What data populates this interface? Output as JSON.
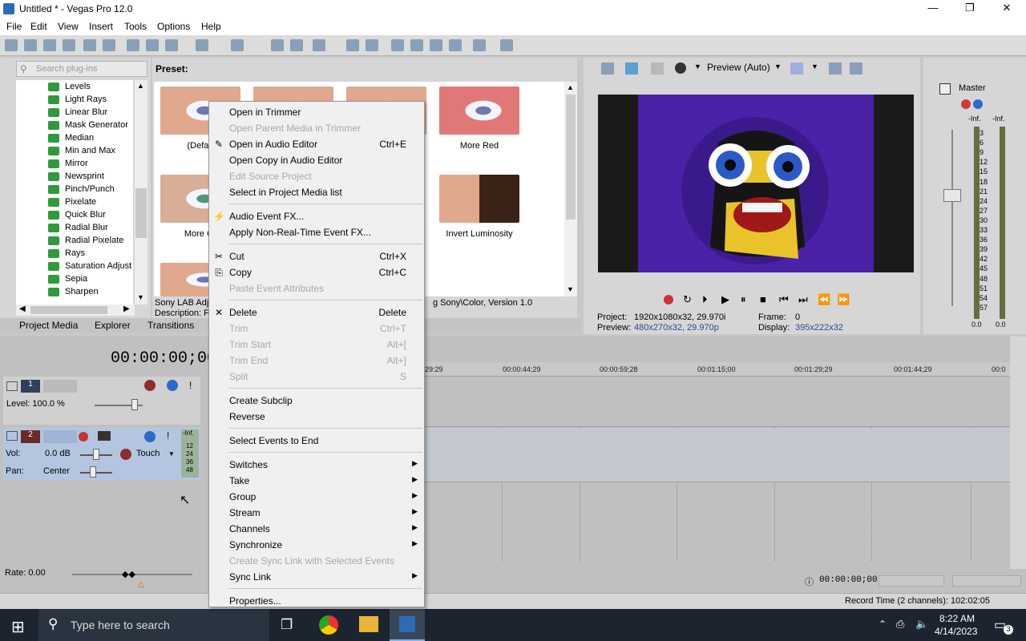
{
  "window": {
    "title": "Untitled * - Vegas Pro 12.0",
    "minimize": "—",
    "maximize": "❐",
    "close": "✕"
  },
  "menu": [
    "File",
    "Edit",
    "View",
    "Insert",
    "Tools",
    "Options",
    "Help"
  ],
  "plugins": {
    "search_placeholder": "Search plug-ins",
    "items": [
      "Levels",
      "Light Rays",
      "Linear Blur",
      "Mask Generator",
      "Median",
      "Min and Max",
      "Mirror",
      "Newsprint",
      "Pinch/Punch",
      "Pixelate",
      "Quick Blur",
      "Radial Blur",
      "Radial Pixelate",
      "Rays",
      "Saturation Adjust",
      "Sepia",
      "Sharpen"
    ]
  },
  "presets": {
    "label": "Preset:",
    "items": [
      "(Defau",
      "More Red",
      "More Gr",
      "Invert Luminosity"
    ],
    "info_line1": "Sony LAB Adju",
    "info_line1_end": "g Sony\\Color, Version 1.0",
    "info_line2": "Description: F"
  },
  "tabs": [
    "Project Media",
    "Explorer",
    "Transitions"
  ],
  "preview": {
    "mode": "Preview (Auto)",
    "project_label": "Project:",
    "project_value": "1920x1080x32, 29.970i",
    "preview_label": "Preview:",
    "preview_value": "480x270x32, 29.970p",
    "frame_label": "Frame:",
    "frame_value": "0",
    "display_label": "Display:",
    "display_value": "395x222x32"
  },
  "mixer": {
    "title": "Master",
    "left_inf": "-Inf.",
    "right_inf": "-Inf.",
    "scale": [
      "3",
      "6",
      "9",
      "12",
      "15",
      "18",
      "21",
      "24",
      "27",
      "30",
      "33",
      "36",
      "39",
      "42",
      "45",
      "48",
      "51",
      "54",
      "57"
    ],
    "left_level": "0.0",
    "right_level": "0.0"
  },
  "timeline": {
    "timecode": "00:00:00;00",
    "ruler": [
      "29:29",
      "00:00:44;29",
      "00:00:59;28",
      "00:01:15;00",
      "00:01:29;29",
      "00:01:44;29",
      "00:0"
    ],
    "track1": {
      "num": "1",
      "level": "Level: 100.0 %"
    },
    "track2": {
      "num": "2",
      "vol_label": "Vol:",
      "vol_value": "0.0 dB",
      "pan_label": "Pan:",
      "pan_value": "Center",
      "mode": "Touch",
      "meter_top": "-Inf.",
      "meter_vals": [
        "12",
        "24",
        "36",
        "48"
      ]
    },
    "rate": "Rate: 0.00",
    "end_time": "00:00:00;00"
  },
  "status": {
    "record_time": "Record Time (2 channels): 102:02:05"
  },
  "context_menu": [
    {
      "label": "Open in Trimmer",
      "shortcut": "",
      "disabled": false,
      "icon": ""
    },
    {
      "label": "Open Parent Media in Trimmer",
      "shortcut": "",
      "disabled": true,
      "icon": ""
    },
    {
      "label": "Open in Audio Editor",
      "shortcut": "Ctrl+E",
      "disabled": false,
      "icon": "✎"
    },
    {
      "label": "Open Copy in Audio Editor",
      "shortcut": "",
      "disabled": false,
      "icon": ""
    },
    {
      "label": "Edit Source Project",
      "shortcut": "",
      "disabled": true,
      "icon": ""
    },
    {
      "label": "Select in Project Media list",
      "shortcut": "",
      "disabled": false,
      "icon": ""
    },
    {
      "sep": true
    },
    {
      "label": "Audio Event FX...",
      "shortcut": "",
      "disabled": false,
      "icon": "⚡"
    },
    {
      "label": "Apply Non-Real-Time Event FX...",
      "shortcut": "",
      "disabled": false,
      "icon": ""
    },
    {
      "sep": true
    },
    {
      "label": "Cut",
      "shortcut": "Ctrl+X",
      "disabled": false,
      "icon": "✂"
    },
    {
      "label": "Copy",
      "shortcut": "Ctrl+C",
      "disabled": false,
      "icon": "⎘"
    },
    {
      "label": "Paste Event Attributes",
      "shortcut": "",
      "disabled": true,
      "icon": ""
    },
    {
      "sep": true
    },
    {
      "label": "Delete",
      "shortcut": "Delete",
      "disabled": false,
      "icon": "✕"
    },
    {
      "label": "Trim",
      "shortcut": "Ctrl+T",
      "disabled": true,
      "icon": ""
    },
    {
      "label": "Trim Start",
      "shortcut": "Alt+[",
      "disabled": true,
      "icon": ""
    },
    {
      "label": "Trim End",
      "shortcut": "Alt+]",
      "disabled": true,
      "icon": ""
    },
    {
      "label": "Split",
      "shortcut": "S",
      "disabled": true,
      "icon": ""
    },
    {
      "sep": true
    },
    {
      "label": "Create Subclip",
      "shortcut": "",
      "disabled": false,
      "icon": ""
    },
    {
      "label": "Reverse",
      "shortcut": "",
      "disabled": false,
      "icon": ""
    },
    {
      "sep": true
    },
    {
      "label": "Select Events to End",
      "shortcut": "",
      "disabled": false,
      "icon": ""
    },
    {
      "sep": true
    },
    {
      "label": "Switches",
      "submenu": true,
      "disabled": false
    },
    {
      "label": "Take",
      "submenu": true,
      "disabled": false
    },
    {
      "label": "Group",
      "submenu": true,
      "disabled": false
    },
    {
      "label": "Stream",
      "submenu": true,
      "disabled": false
    },
    {
      "label": "Channels",
      "submenu": true,
      "disabled": false
    },
    {
      "label": "Synchronize",
      "submenu": true,
      "disabled": false
    },
    {
      "label": "Create Sync Link with Selected Events",
      "shortcut": "",
      "disabled": true
    },
    {
      "label": "Sync Link",
      "submenu": true,
      "disabled": false
    },
    {
      "sep": true
    },
    {
      "label": "Properties...",
      "shortcut": "",
      "disabled": false
    }
  ],
  "taskbar": {
    "search": "Type here to search",
    "time": "8:22 AM",
    "date": "4/14/2023",
    "notifications": "3"
  }
}
